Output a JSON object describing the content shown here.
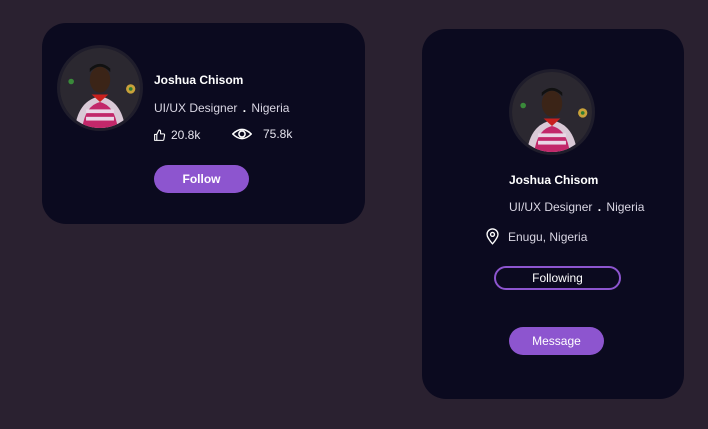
{
  "cards": [
    {
      "name": "Joshua Chisom",
      "role": "UI/UX Designer",
      "separator": ".",
      "country": "Nigeria",
      "likes": "20.8k",
      "views": "75.8k",
      "follow_label": "Follow"
    },
    {
      "name": "Joshua Chisom",
      "role": "UI/UX Designer",
      "separator": ".",
      "country": "Nigeria",
      "location": "Enugu, Nigeria",
      "following_label": "Following",
      "message_label": "Message"
    }
  ],
  "colors": {
    "background": "#2a2130",
    "card": "#0b0a1f",
    "accent": "#8d55cf"
  },
  "icons": [
    "thumbs-up-icon",
    "eye-icon",
    "location-pin-icon"
  ]
}
